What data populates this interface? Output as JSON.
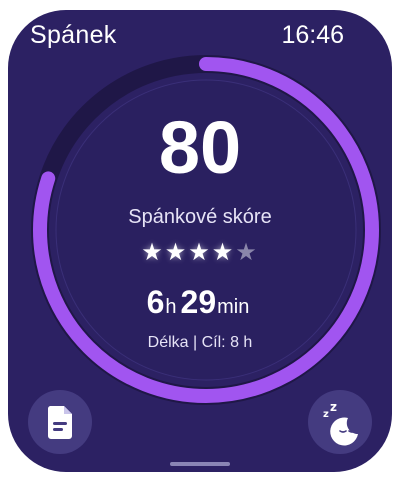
{
  "header": {
    "title": "Spánek",
    "time": "16:46"
  },
  "score": {
    "value": "80",
    "label": "Spánkové skóre",
    "ring_fraction": 0.8
  },
  "rating": {
    "stars_filled": 4,
    "stars_total": 5
  },
  "duration": {
    "hours": "6",
    "hours_unit": "h",
    "minutes": "29",
    "minutes_unit": "min",
    "label": "Délka | Cíl: 8 h"
  },
  "buttons": {
    "left_icon": "document-icon",
    "right_icon": "sleep-moon-icon"
  },
  "colors": {
    "background": "#2c2163",
    "ring_progress": "#a155f0",
    "ring_track": "#1f1747",
    "button": "#443b80"
  }
}
